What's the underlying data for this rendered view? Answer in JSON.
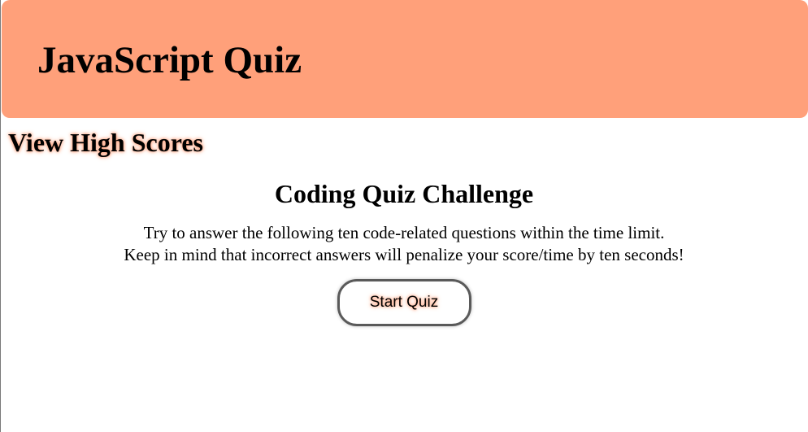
{
  "header": {
    "title": "JavaScript Quiz",
    "color": "#ffa07a"
  },
  "nav": {
    "high_scores_label": "View High Scores"
  },
  "intro": {
    "heading": "Coding Quiz Challenge",
    "line1": "Try to answer the following ten code-related questions within the time limit.",
    "line2": "Keep in mind that incorrect answers will penalize your score/time by ten seconds!",
    "start_label": "Start Quiz"
  }
}
